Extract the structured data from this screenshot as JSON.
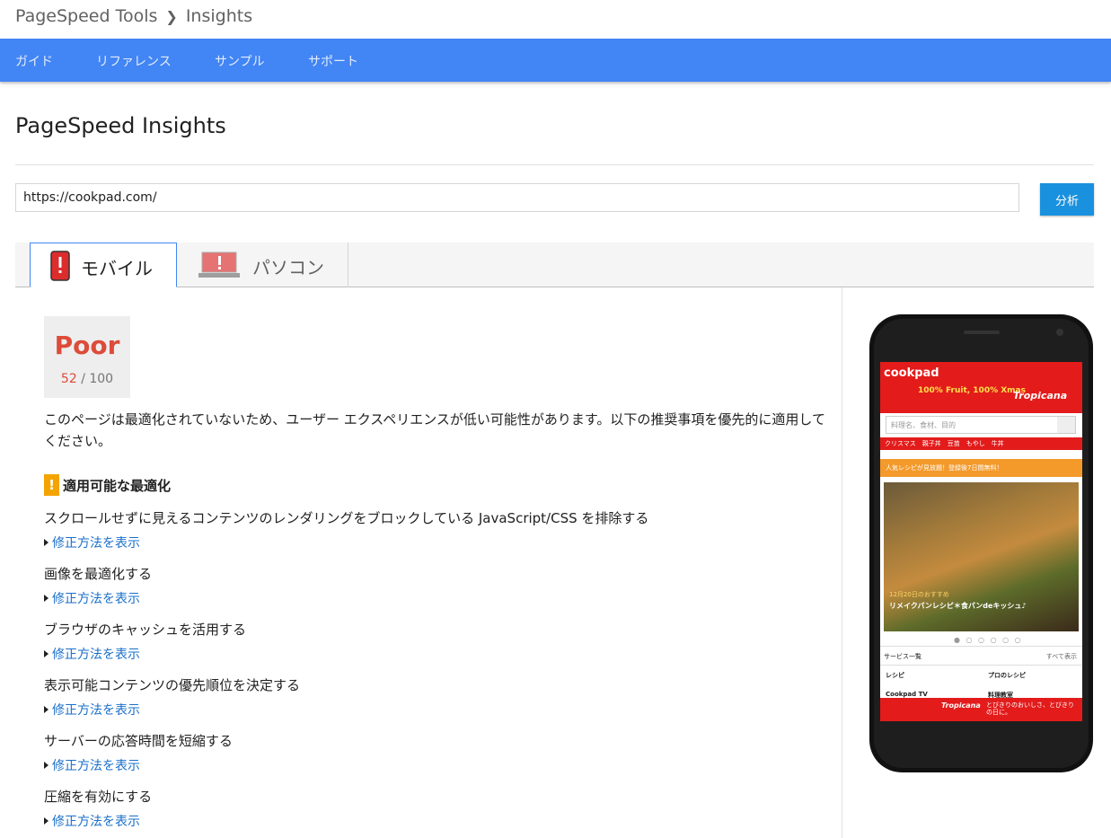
{
  "breadcrumb": {
    "root": "PageSpeed Tools",
    "current": "Insights"
  },
  "nav": [
    "ガイド",
    "リファレンス",
    "サンプル",
    "サポート"
  ],
  "page_title": "PageSpeed Insights",
  "url_input": {
    "value": "https://cookpad.com/"
  },
  "analyze_button": "分析",
  "tabs": {
    "mobile": "モバイル",
    "desktop": "パソコン"
  },
  "score": {
    "label": "Poor",
    "value": "52",
    "max": "/ 100"
  },
  "summary": "このページは最適化されていないため、ユーザー エクスペリエンスが低い可能性があります。以下の推奨事項を優先的に適用してください。",
  "section": {
    "icon": "!",
    "title": "適用可能な最適化"
  },
  "rules": [
    {
      "title": "スクロールせずに見えるコンテンツのレンダリングをブロックしている JavaScript/CSS を排除する",
      "link": "修正方法を表示"
    },
    {
      "title": "画像を最適化する",
      "link": "修正方法を表示"
    },
    {
      "title": "ブラウザのキャッシュを活用する",
      "link": "修正方法を表示"
    },
    {
      "title": "表示可能コンテンツの優先順位を決定する",
      "link": "修正方法を表示"
    },
    {
      "title": "サーバーの応答時間を短縮する",
      "link": "修正方法を表示"
    },
    {
      "title": "圧縮を有効にする",
      "link": "修正方法を表示"
    }
  ],
  "preview": {
    "logo": "cookpad",
    "promo": "100% Fruit, 100% Xmas",
    "brand": "Tropicana",
    "search_placeholder": "料理名、食材、目的",
    "keywords": "クリスマス　親子丼　豆苗　もやし　牛丼",
    "banner": "人気レシピが見放題！登録後7日間無料！",
    "photo_date": "12月20日のおすすめ",
    "photo_title": "リメイクパンレシピ＊食パンdeキッシュ♪",
    "services_title": "サービス一覧",
    "services_all": "すべて表示",
    "cells": [
      "レシピ",
      "プロのレシピ",
      "Cookpad TV",
      "料理教室"
    ],
    "footer": "とびきりのおいしさ、とびきりの日に。"
  },
  "colors": {
    "nav": "#4285f4",
    "poor": "#dd4b39",
    "warning": "#f4a400",
    "link": "#1a6fc9",
    "button": "#1a91de"
  }
}
